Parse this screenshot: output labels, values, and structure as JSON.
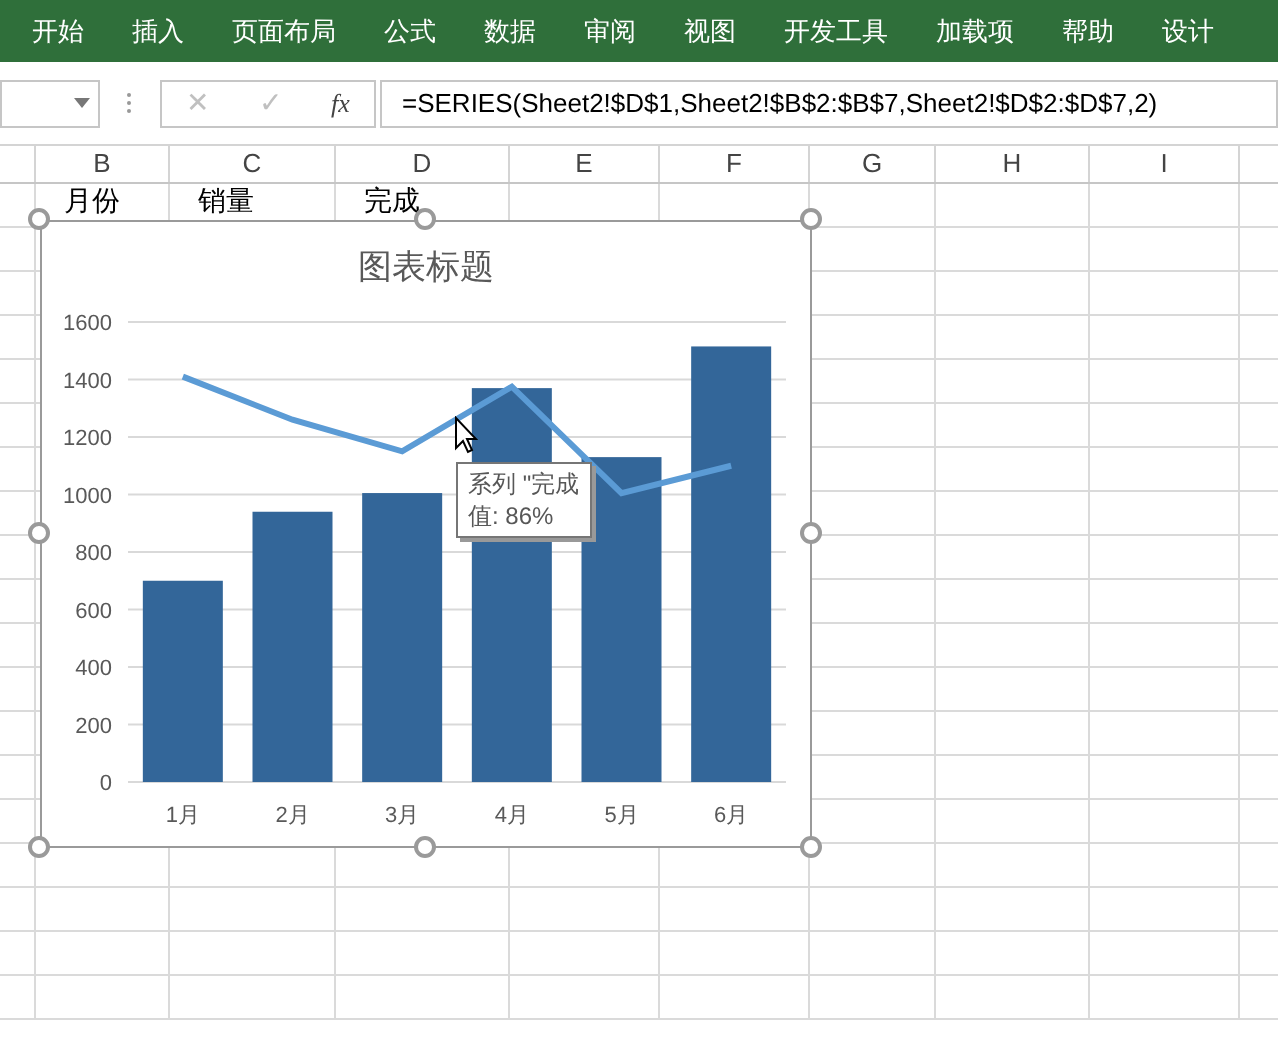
{
  "ribbon_tabs": [
    {
      "label": "开始"
    },
    {
      "label": "插入"
    },
    {
      "label": "页面布局"
    },
    {
      "label": "公式"
    },
    {
      "label": "数据"
    },
    {
      "label": "审阅"
    },
    {
      "label": "视图"
    },
    {
      "label": "开发工具"
    },
    {
      "label": "加载项"
    },
    {
      "label": "帮助"
    },
    {
      "label": "设计"
    }
  ],
  "formula_bar": {
    "cancel": "✕",
    "enter": "✓",
    "function": "fx",
    "formula": "=SERIES(Sheet2!$D$1,Sheet2!$B$2:$B$7,Sheet2!$D$2:$D$7,2)"
  },
  "columns": [
    "B",
    "C",
    "D",
    "E",
    "F",
    "G",
    "H",
    "I"
  ],
  "row_1": [
    "月份",
    "销量",
    "完成"
  ],
  "chart": {
    "title": "图表标题",
    "chart_data": {
      "type": "bar",
      "categories": [
        "1月",
        "2月",
        "3月",
        "4月",
        "5月",
        "6月"
      ],
      "ylim": [
        0,
        1600
      ],
      "yticks": [
        0,
        200,
        400,
        600,
        800,
        1000,
        1200,
        1400,
        1600
      ],
      "grid": true,
      "series": [
        {
          "type": "bar",
          "color": "#336699",
          "values": [
            700,
            940,
            1005,
            1370,
            1130,
            1515
          ]
        },
        {
          "type": "line",
          "color": "#5b9bd5",
          "values": [
            1410,
            1260,
            1150,
            1375,
            1005,
            1100
          ]
        }
      ]
    }
  },
  "tooltip": {
    "lines": [
      "系列 \"完成",
      "值: 86%"
    ]
  }
}
